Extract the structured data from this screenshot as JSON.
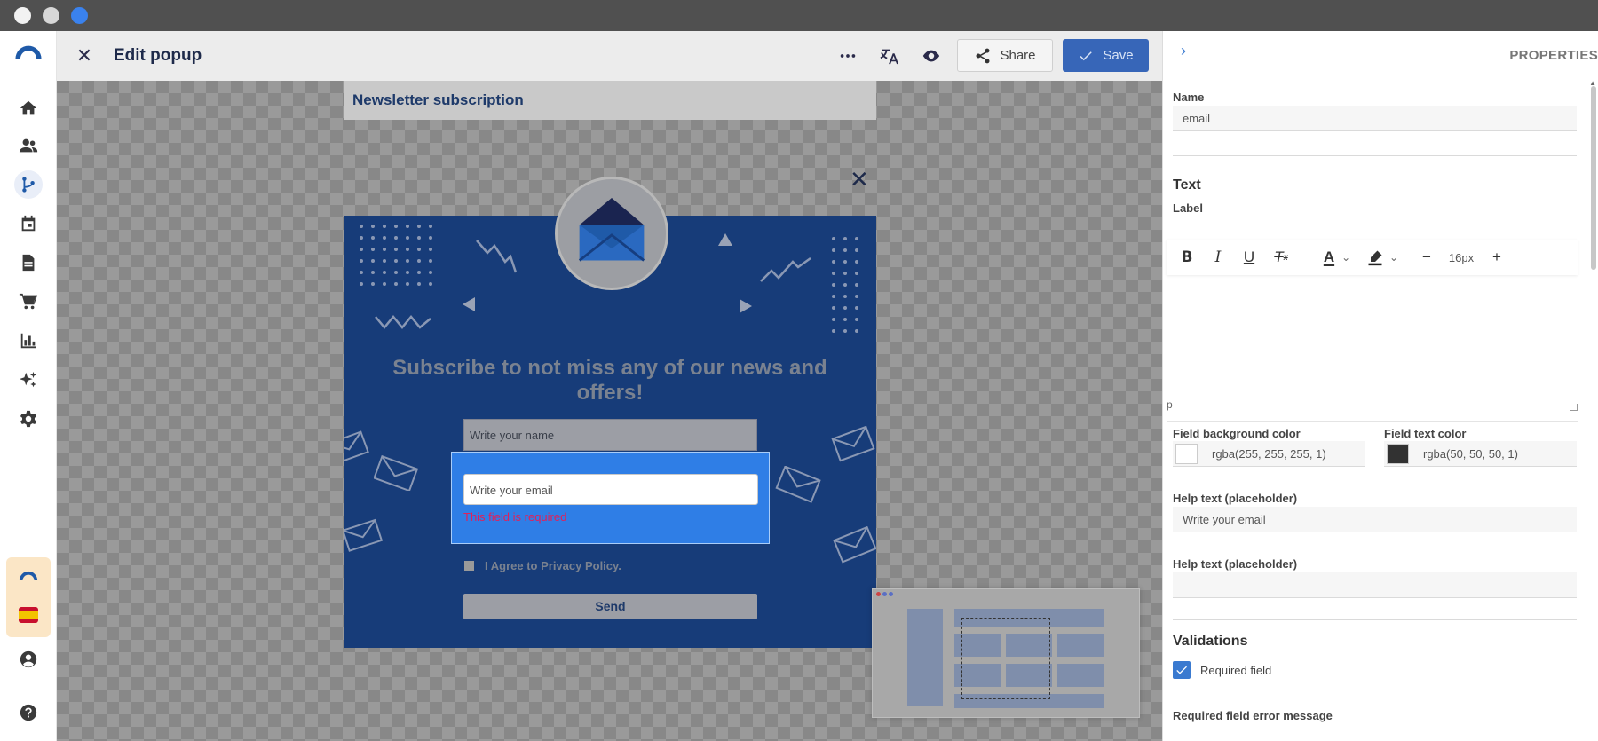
{
  "window": {
    "controls": [
      "close",
      "minimize",
      "zoom"
    ]
  },
  "sidebar": {
    "items": [
      {
        "icon": "home-icon"
      },
      {
        "icon": "contacts-icon"
      },
      {
        "icon": "automation-icon",
        "active": true
      },
      {
        "icon": "calendar-icon"
      },
      {
        "icon": "document-icon"
      },
      {
        "icon": "cart-icon"
      },
      {
        "icon": "analytics-icon"
      },
      {
        "icon": "sparkles-icon"
      },
      {
        "icon": "settings-icon"
      }
    ],
    "bottom": [
      {
        "icon": "account-icon"
      },
      {
        "icon": "help-icon"
      }
    ]
  },
  "header": {
    "title": "Edit popup",
    "share_label": "Share",
    "save_label": "Save"
  },
  "canvas": {
    "popup_name": "Newsletter subscription",
    "heading": "Subscribe to not miss any of our news and offers!",
    "name_placeholder": "Write your name",
    "email_placeholder": "Write your email",
    "error_message": "This field is required",
    "agree_label": "I Agree to Privacy Policy.",
    "send_label": "Send"
  },
  "panel": {
    "title": "PROPERTIES",
    "name_label": "Name",
    "name_value": "email",
    "text_section": "Text",
    "label_label": "Label",
    "font_size": "16px",
    "editor_tag": "p",
    "field_bg_label": "Field background color",
    "field_bg_value": "rgba(255, 255, 255, 1)",
    "field_text_label": "Field text color",
    "field_text_value": "rgba(50, 50, 50, 1)",
    "help_text_label": "Help text (placeholder)",
    "help_text_value": "Write your email",
    "help_text_label_2": "Help text (placeholder)",
    "help_text_value_2": "",
    "validations_section": "Validations",
    "required_label": "Required field",
    "required_checked": true,
    "required_error_label": "Required field error message"
  },
  "colors": {
    "accent": "#3766b8",
    "popup_bg": "#173c79",
    "selection": "#2f7ee6",
    "error": "#e0205a"
  }
}
